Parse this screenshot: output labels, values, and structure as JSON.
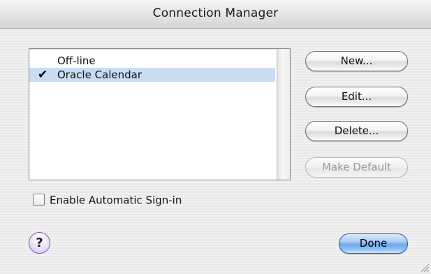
{
  "window": {
    "title": "Connection Manager"
  },
  "connections": {
    "items": [
      {
        "label": "Off-line",
        "checked": false,
        "selected": false
      },
      {
        "label": "Oracle Calendar",
        "checked": true,
        "selected": true
      }
    ],
    "check_glyph": "✔"
  },
  "buttons": {
    "new": "New...",
    "edit": "Edit...",
    "delete": "Delete...",
    "make_default": "Make Default",
    "done": "Done"
  },
  "options": {
    "auto_signin_label": "Enable Automatic Sign-in",
    "auto_signin_checked": false
  },
  "help": {
    "glyph": "?"
  },
  "colors": {
    "selection": "#c9dcf2",
    "default_button": "#6ea7e9",
    "help_button": "#d8c6f1"
  },
  "icons": {
    "check": "checkmark-icon",
    "help": "question-mark-icon",
    "resize": "resize-grip-icon"
  }
}
